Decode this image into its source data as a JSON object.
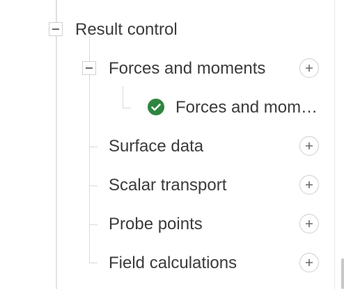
{
  "tree": {
    "result_control": {
      "label": "Result control",
      "toggle": "collapse"
    },
    "forces_and_moments": {
      "label": "Forces and moments",
      "toggle": "collapse",
      "add_icon": "plus-icon"
    },
    "forces_child": {
      "label": "Forces and mom…",
      "status_icon": "check-circle-icon",
      "status_color": "#2e8540"
    },
    "surface_data": {
      "label": "Surface data",
      "add_icon": "plus-icon"
    },
    "scalar_transport": {
      "label": "Scalar transport",
      "add_icon": "plus-icon"
    },
    "probe_points": {
      "label": "Probe points",
      "add_icon": "plus-icon"
    },
    "field_calculations": {
      "label": "Field calculations",
      "add_icon": "plus-icon"
    }
  }
}
